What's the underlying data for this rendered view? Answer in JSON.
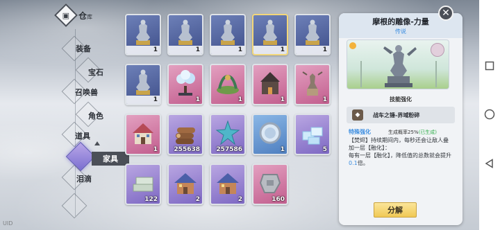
{
  "sidebar": {
    "title": "仓",
    "title_small": "库",
    "badge": "▣",
    "items": [
      {
        "label": "装备"
      },
      {
        "label": "宝石"
      },
      {
        "label": "召唤兽"
      },
      {
        "label": "角色"
      },
      {
        "label": "道具"
      },
      {
        "label": "家具"
      },
      {
        "label": "泪滴"
      }
    ]
  },
  "grid": {
    "items": [
      {
        "count": "1",
        "icon": "statue-icon",
        "bg": "blue"
      },
      {
        "count": "1",
        "icon": "statue-icon",
        "bg": "blue"
      },
      {
        "count": "1",
        "icon": "statue-icon",
        "bg": "blue"
      },
      {
        "count": "1",
        "icon": "statue-icon",
        "bg": "blue"
      },
      {
        "count": "1",
        "icon": "statue-icon",
        "bg": "blue"
      },
      {
        "count": "1",
        "icon": "statue-icon",
        "bg": "blue"
      },
      {
        "count": "1",
        "icon": "crystal-tree-icon",
        "bg": "pink"
      },
      {
        "count": "1",
        "icon": "serpent-shrine-icon",
        "bg": "pink"
      },
      {
        "count": "1",
        "icon": "manor-icon",
        "bg": "pink"
      },
      {
        "count": "1",
        "icon": "fountain-statue-icon",
        "bg": "pink"
      },
      {
        "count": "1",
        "icon": "house-icon",
        "bg": "pink"
      },
      {
        "count": "255638",
        "icon": "logs-icon",
        "bg": "purple"
      },
      {
        "count": "257586",
        "icon": "star-crystal-icon",
        "bg": "purple"
      },
      {
        "count": "1",
        "icon": "mirror-icon",
        "bg": "blue2"
      },
      {
        "count": "5",
        "icon": "ice-blocks-icon",
        "bg": "purple"
      },
      {
        "count": "122",
        "icon": "stone-bricks-icon",
        "bg": "purple"
      },
      {
        "count": "2",
        "icon": "cottage-icon",
        "bg": "purple"
      },
      {
        "count": "2",
        "icon": "cottage-icon",
        "bg": "purple"
      },
      {
        "count": "160",
        "icon": "stone-part-icon",
        "bg": "pink"
      }
    ]
  },
  "detail": {
    "title": "摩根的雕像-力量",
    "rarity": "传说",
    "skill_section": "技能强化",
    "skill_name": "战车之锤-界域粉碎",
    "skill_type": "特殊强化",
    "rate_label": "生成概率25%",
    "rate_status": "(已生成)",
    "desc_1": "【焚烬】持续期间内，每秒还会让敌人叠加一层【融化】：",
    "desc_2": "每有一层【融化】，降低值的总数就会提升",
    "desc_value": "0.1",
    "desc_3": "倍。",
    "decompose_label": "分解",
    "close": "✕"
  },
  "footer": {
    "uid": "UID"
  },
  "colors": {
    "accent_blue": "#3b8de0",
    "button_gold": "#f0c955",
    "active_purple": "#7b6fd0"
  }
}
